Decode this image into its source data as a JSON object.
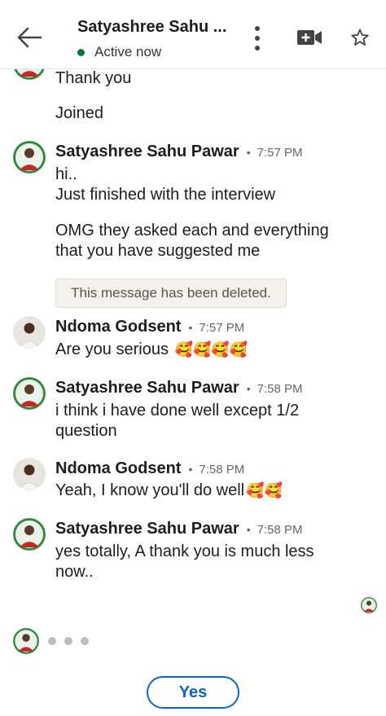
{
  "header": {
    "title": "Satyashree Sahu ...",
    "status": "Active now",
    "status_color": "#057642",
    "icons": [
      "back-arrow-icon",
      "more-vertical-icon",
      "video-call-icon",
      "star-icon"
    ]
  },
  "messages": {
    "prev_1": "Thank you",
    "prev_2": "Joined",
    "g1": {
      "sender": "Satyashree Sahu Pawar",
      "sep": "•",
      "time": "7:57 PM",
      "line1": "hi..",
      "line2": "Just finished with the interview",
      "line3": "OMG they  asked each and everything",
      "line4": "that you have suggested me",
      "deleted": "This message has been deleted."
    },
    "g2": {
      "sender": "Ndoma Godsent",
      "sep": "•",
      "time": "7:57 PM",
      "text": "Are you serious",
      "emoji": "🥰🥰🥰🥰"
    },
    "g3": {
      "sender": "Satyashree Sahu Pawar",
      "sep": "•",
      "time": "7:58 PM",
      "line1": "i think i have done well except 1/2",
      "line2": "question"
    },
    "g4": {
      "sender": "Ndoma Godsent",
      "sep": "•",
      "time": "7:58 PM",
      "text": "Yeah, I know you'll do well",
      "emoji": "🥰🥰"
    },
    "g5": {
      "sender": "Satyashree Sahu Pawar",
      "sep": "•",
      "time": "7:58 PM",
      "line1": "yes totally, A thank you is much less",
      "line2": "now.."
    }
  },
  "reply": {
    "yes_label": "Yes",
    "accent": "#0a66c2"
  }
}
